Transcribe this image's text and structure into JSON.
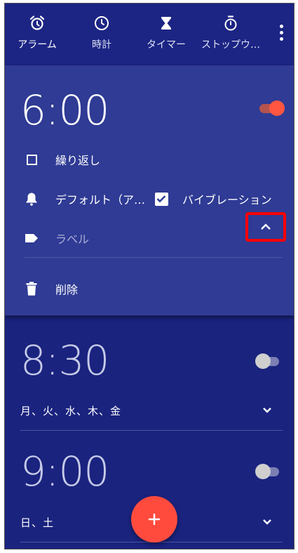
{
  "tabs": [
    {
      "label": "アラーム",
      "icon": "alarm-icon"
    },
    {
      "label": "時計",
      "icon": "clock-icon"
    },
    {
      "label": "タイマー",
      "icon": "hourglass-icon"
    },
    {
      "label": "ストップウ…",
      "icon": "stopwatch-icon"
    }
  ],
  "alarms": [
    {
      "time": "6:00",
      "enabled": true,
      "expanded": true,
      "repeat_label": "繰り返し",
      "repeat_checked": false,
      "ringtone_label": "デフォルト（ア…",
      "vibrate_label": "バイブレーション",
      "vibrate_checked": true,
      "label_placeholder": "ラベル",
      "delete_label": "削除"
    },
    {
      "time": "8:30",
      "enabled": false,
      "days": "月、火、水、木、金"
    },
    {
      "time": "9:00",
      "enabled": false,
      "days": "日、土"
    }
  ],
  "colors": {
    "background": "#1a237e",
    "expanded_card": "#2f3b94",
    "accent": "#ff5641",
    "highlight": "#ff0000"
  }
}
